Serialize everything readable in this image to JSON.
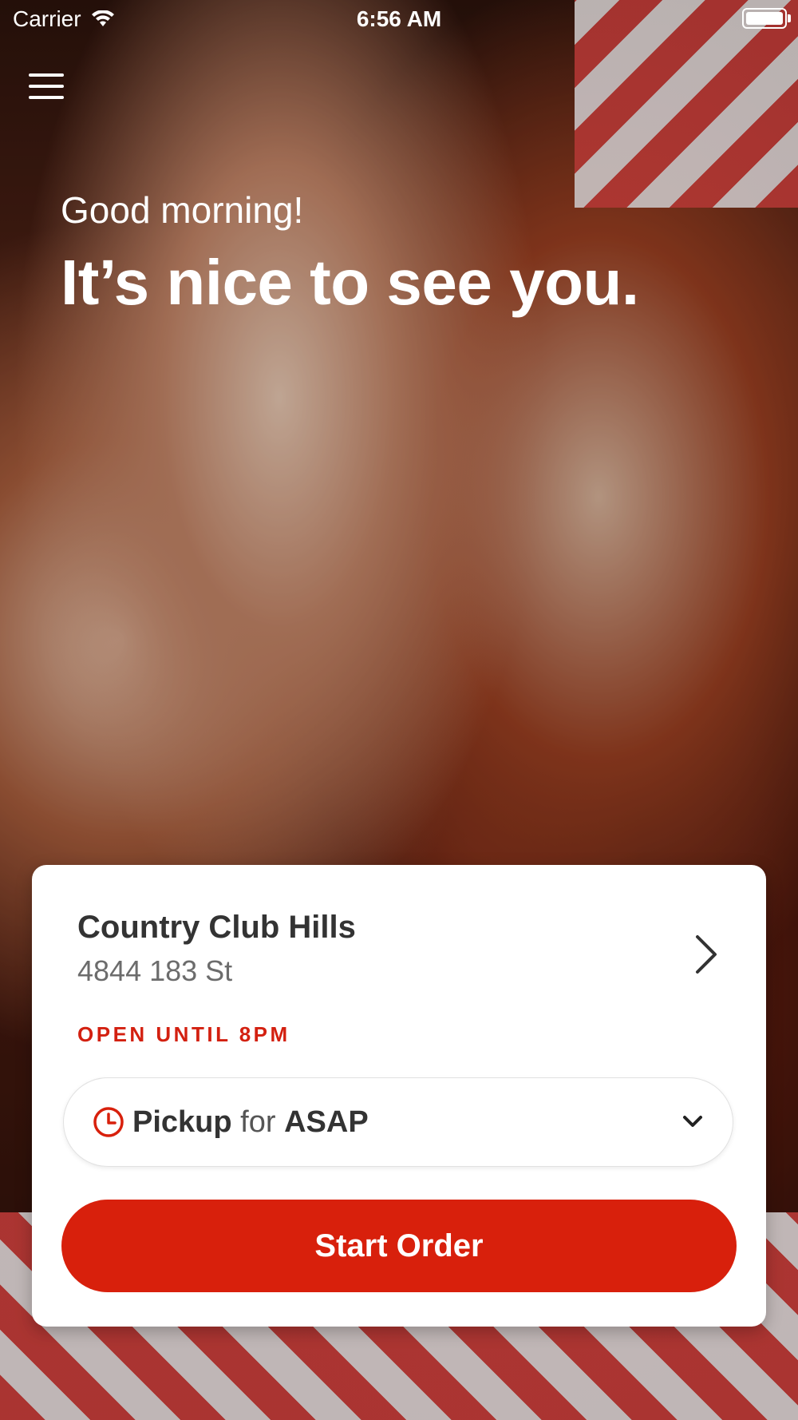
{
  "status_bar": {
    "carrier": "Carrier",
    "time": "6:56 AM"
  },
  "greeting": {
    "small": "Good morning!",
    "big": "It’s nice to see you."
  },
  "location": {
    "name": "Country Club Hills",
    "address": "4844 183 St",
    "open_status": "OPEN UNTIL 8PM"
  },
  "order_mode": {
    "mode": "Pickup",
    "connector": "for",
    "time": "ASAP"
  },
  "actions": {
    "start_order": "Start Order"
  },
  "colors": {
    "accent": "#d8200c",
    "text_dark": "#333333",
    "text_muted": "#6c6c6c"
  },
  "icons": {
    "menu": "hamburger-menu-icon",
    "location_chevron": "chevron-right-icon",
    "pickup_clock": "clock-icon",
    "pickup_chevron": "chevron-down-icon"
  }
}
